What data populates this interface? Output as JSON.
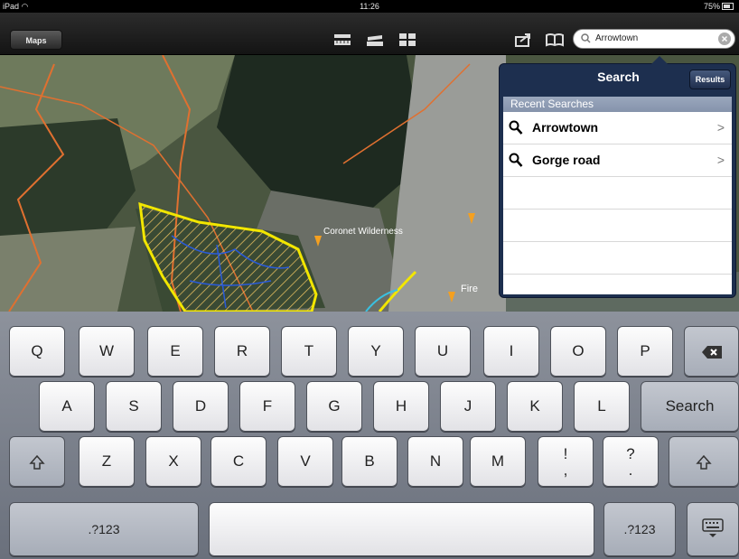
{
  "status": {
    "carrier": "iPad",
    "time": "11:26",
    "battery": "75%"
  },
  "toolbar": {
    "maps_label": "Maps"
  },
  "search": {
    "value": "Arrowtown"
  },
  "popover": {
    "title": "Search",
    "results_label": "Results",
    "section_header": "Recent Searches",
    "items": [
      {
        "label": "Arrowtown",
        "chevron": ">"
      },
      {
        "label": "Gorge road",
        "chevron": ">"
      }
    ]
  },
  "map": {
    "labels": [
      "Coronet Wilderness",
      "Fire"
    ],
    "colors": {
      "boundary_yellow": "#f2e600",
      "boundary_orange": "#e07030",
      "streams_blue": "#2a5bd8",
      "marker": "#f4a020"
    }
  },
  "keyboard": {
    "row1": [
      "Q",
      "W",
      "E",
      "R",
      "T",
      "Y",
      "U",
      "I",
      "O",
      "P"
    ],
    "row2": [
      "A",
      "S",
      "D",
      "F",
      "G",
      "H",
      "J",
      "K",
      "L"
    ],
    "row3": [
      "Z",
      "X",
      "C",
      "V",
      "B",
      "N",
      "M"
    ],
    "search_key": "Search",
    "numbers_key": ".?123",
    "punct_1_top": "!",
    "punct_1_bottom": ",",
    "punct_2_top": "?",
    "punct_2_bottom": "."
  }
}
